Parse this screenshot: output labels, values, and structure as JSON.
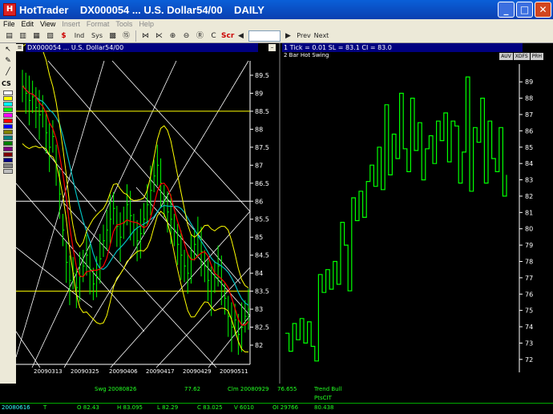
{
  "window": {
    "app_name": "HotTrader",
    "title": "HotTrader    DX000054 ... U.S. Dollar54/00    DAILY",
    "minimize": "_",
    "maximize": "□",
    "close": "✕"
  },
  "menu": [
    "File",
    "Edit",
    "View",
    "Insert",
    "Format",
    "Tools",
    "Help"
  ],
  "toolbar": {
    "prev": "Prev",
    "next": "Next",
    "scr": "Scr"
  },
  "left_panel": {
    "title": "DX000054 ... U.S. Dollar54/00",
    "cs_label": "CS",
    "price_axis": [
      "89.5",
      "89",
      "88.5",
      "88",
      "87.5",
      "87",
      "86.5",
      "86",
      "85.5",
      "85",
      "84.5",
      "84",
      "83.5",
      "83",
      "82.5",
      "82"
    ],
    "date_labels": [
      "20090313",
      "20090325",
      "20090406",
      "20090417",
      "20090429",
      "20090511"
    ],
    "swatch_colors": [
      "#ffffff",
      "#ffff00",
      "#00ffff",
      "#00ff00",
      "#ff00ff",
      "#ff0000",
      "#0000ff",
      "#808000",
      "#008080",
      "#008000",
      "#800080",
      "#800000",
      "#000080",
      "#808080",
      "#c0c0c0"
    ]
  },
  "right_panel": {
    "line1": "1 Tick = 0.01    SL = 83.1    CI = 83.0",
    "line2": "2  Bar Hot Swing",
    "tabs": [
      "AUV",
      "XDFS",
      "PRH"
    ],
    "price_axis": [
      "89",
      "88",
      "87",
      "86",
      "85",
      "84",
      "83",
      "82",
      "81",
      "80",
      "79",
      "78",
      "77",
      "76",
      "75",
      "74",
      "73",
      "72"
    ]
  },
  "status": {
    "swg_label": "Swg 20080826",
    "swg_value": "77.62",
    "clm_label": "Clm 20080929",
    "clm_value": "76.655",
    "trend_label": "Trend Bull",
    "ptscit_label": "PtsCIT",
    "date": "20080616",
    "t": "T",
    "open": "O 82.43",
    "high": "H 83.095",
    "low": "L 82.29",
    "close": "C 83.025",
    "volume": "V 6010",
    "oi": "OI 29766",
    "last": "80.438"
  },
  "colors": {
    "title_bar": "#0a4fd0",
    "chrome": "#ece9d8",
    "envelope": "#ffff00",
    "ma_fast": "#ff0000",
    "ma_slow": "#00bfbf",
    "bars": "#00ff00",
    "swing": "#00ff00"
  }
}
